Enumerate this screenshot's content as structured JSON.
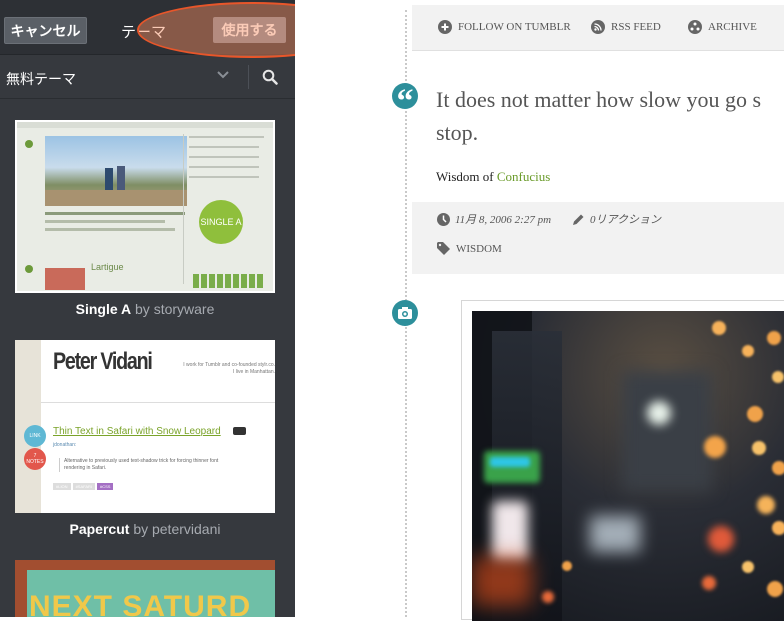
{
  "sidebar": {
    "cancel_label": "キャンセル",
    "title": "テーマ",
    "use_label": "使用する",
    "filter_label": "無料テーマ",
    "themes": [
      {
        "name": "Single A",
        "by": "by storyware"
      },
      {
        "name": "Papercut",
        "by": "by petervidani"
      },
      {
        "name": "",
        "by": ""
      }
    ],
    "thumb_single_a": {
      "badge": "SINGLE A",
      "heading": "Lartigue"
    },
    "thumb_papercut": {
      "logo": "Peter Vidani",
      "intro_line1": "I work for Tumblr and co-founded stylr.co.",
      "intro_line2": "I live in Manhattan.",
      "post_title": "Thin Text in Safari with Snow Leopard",
      "author": "jdonathan:",
      "excerpt_line1": "Alternative to previously used text-shadow trick for forcing thinner font",
      "excerpt_line2": "rendering in Safari.",
      "link_label": "LINK",
      "notes_count": "7",
      "notes_label": "NOTES",
      "tags": [
        "#LION",
        "#SAFARI",
        "#CSS"
      ]
    },
    "thumb_third": {
      "text": "NEXT SATURD"
    }
  },
  "main": {
    "nav": {
      "follow": "FOLLOW ON TUMBLR",
      "rss": "RSS FEED",
      "archive": "ARCHIVE"
    },
    "quote_line1": "It does not matter how slow you go s",
    "quote_line2": "stop.",
    "source_prefix": "Wisdom of",
    "source_link": "Confucius",
    "date": "11月 8, 2006 2:27 pm",
    "reactions": "0リアクション",
    "tag": "WISDOM"
  },
  "colors": {
    "accent": "#2d8f9b",
    "link": "#6a9b2a",
    "highlight": "#e8562a"
  }
}
